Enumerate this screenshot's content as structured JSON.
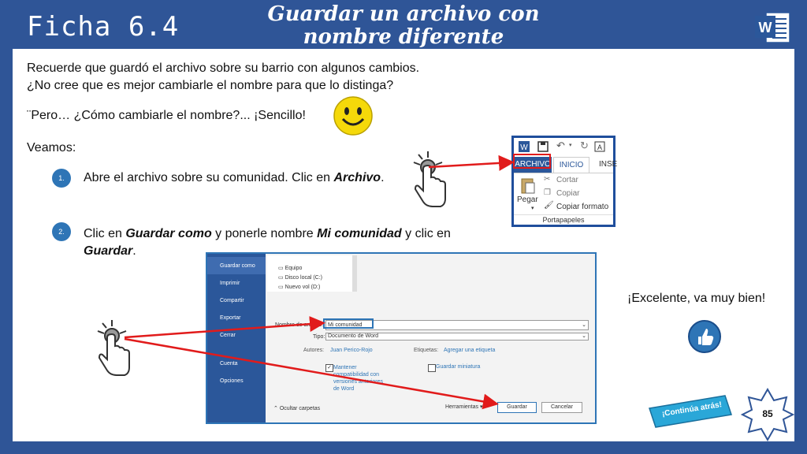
{
  "header": {
    "ficha": "Ficha 6.4",
    "title_line1": "Guardar un archivo con",
    "title_line2": "nombre diferente"
  },
  "content": {
    "intro_line1": "Recuerde que guardó el archivo sobre su barrio con algunos cambios.",
    "intro_line2": "¿No cree que es mejor cambiarle el nombre para que lo distinga?",
    "question": "¨Pero… ¿Cómo cambiarle el nombre?... ¡Sencillo!",
    "veamos": "Veamos:",
    "step1_num": "1.",
    "step1_text": "Abre el archivo sobre su comunidad. Clic en ",
    "step1_bold": "Archivo",
    "step1_end": ".",
    "step2_num": "2.",
    "step2_a": "Clic en ",
    "step2_b": "Guardar como",
    "step2_c": " y ponerle nombre ",
    "step2_d": "Mi comunidad",
    "step2_e": " y clic en",
    "step2_f": "Guardar",
    "step2_g": ".",
    "excelente": "¡Excelente, va muy bien!",
    "continua": "¡Continúa atrás!",
    "page_number": "85"
  },
  "ribbon": {
    "tab_archivo": "ARCHIVO",
    "tab_inicio": "INICIO",
    "tab_insertar": "INSE",
    "paste": "Pegar",
    "cut": "Cortar",
    "copy": "Copiar",
    "format": "Copiar formato",
    "group": "Portapapeles"
  },
  "dialog": {
    "side": [
      "Guardar como",
      "Imprimir",
      "Compartir",
      "Exportar",
      "Cerrar",
      "Cuenta",
      "Opciones"
    ],
    "tree": [
      "Equipo",
      "Disco local (C:)",
      "Nuevo vol (D:)"
    ],
    "name_label": "Nombre de archivo:",
    "name_value": "Mi comunidad",
    "type_label": "Tipo:",
    "type_value": "Documento de Word",
    "authors_label": "Autores:",
    "authors_value": "Juan Perico-Rojo",
    "tags_label": "Etiquetas:",
    "tags_value": "Agregar una etiqueta",
    "compat": "Mantener compatibilidad con versiones anteriores de Word",
    "thumb": "Guardar miniatura",
    "hide": "Ocultar carpetas",
    "tools": "Herramientas",
    "save": "Guardar",
    "cancel": "Cancelar"
  },
  "colors": {
    "background": "#2f5597",
    "accent": "#2e75b6",
    "arrow": "#e11b1b"
  }
}
